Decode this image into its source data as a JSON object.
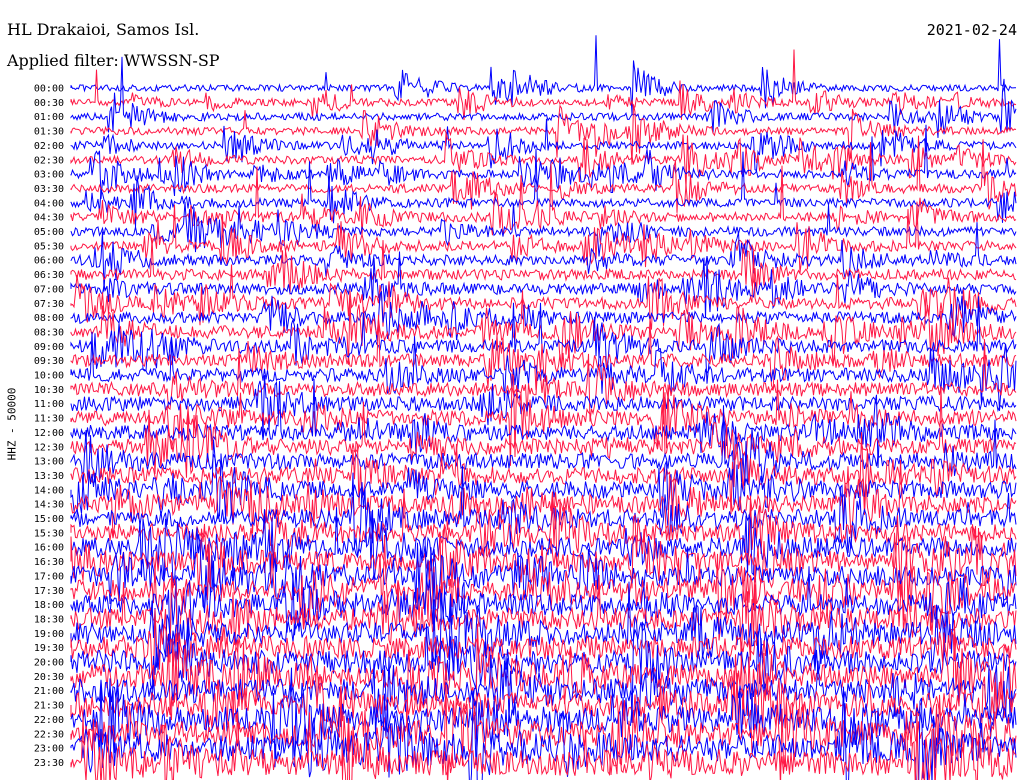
{
  "header": {
    "station": "HL Drakaioi, Samos Isl.",
    "date": "2021-02-24",
    "filter": "Applied filter: WWSSN-SP",
    "channel": "HHZ - 50000"
  },
  "colors": {
    "trace_a": "#0000ff",
    "trace_b": "#ff1744",
    "background": "#ffffff",
    "text": "#000000"
  },
  "chart_data": {
    "type": "line",
    "chart_kind": "helicorder",
    "grid": false,
    "trace_colors_alternating": [
      "#0000ff",
      "#ff1744"
    ],
    "row_labels": [
      "00:00",
      "00:30",
      "01:00",
      "01:30",
      "02:00",
      "02:30",
      "03:00",
      "03:30",
      "04:00",
      "04:30",
      "05:00",
      "05:30",
      "06:00",
      "06:30",
      "07:00",
      "07:30",
      "08:00",
      "08:30",
      "09:00",
      "09:30",
      "10:00",
      "10:30",
      "11:00",
      "11:30",
      "12:00",
      "12:30",
      "13:00",
      "13:30",
      "14:00",
      "14:30",
      "15:00",
      "15:30",
      "16:00",
      "16:30",
      "17:00",
      "17:30",
      "18:00",
      "18:30",
      "19:00",
      "19:30",
      "20:00",
      "20:30",
      "21:00",
      "21:30",
      "22:00",
      "22:30",
      "23:00",
      "23:30"
    ],
    "rows": [
      {
        "label": "00:00",
        "color": "#0000ff",
        "level": 0.1
      },
      {
        "label": "00:30",
        "color": "#ff1744",
        "level": 0.12
      },
      {
        "label": "01:00",
        "color": "#0000ff",
        "level": 0.14
      },
      {
        "label": "01:30",
        "color": "#ff1744",
        "level": 0.15
      },
      {
        "label": "02:00",
        "color": "#0000ff",
        "level": 0.16
      },
      {
        "label": "02:30",
        "color": "#ff1744",
        "level": 0.17
      },
      {
        "label": "03:00",
        "color": "#0000ff",
        "level": 0.18
      },
      {
        "label": "03:30",
        "color": "#ff1744",
        "level": 0.18
      },
      {
        "label": "04:00",
        "color": "#0000ff",
        "level": 0.2
      },
      {
        "label": "04:30",
        "color": "#ff1744",
        "level": 0.22
      },
      {
        "label": "05:00",
        "color": "#0000ff",
        "level": 0.22
      },
      {
        "label": "05:30",
        "color": "#ff1744",
        "level": 0.24
      },
      {
        "label": "06:00",
        "color": "#0000ff",
        "level": 0.26
      },
      {
        "label": "06:30",
        "color": "#ff1744",
        "level": 0.28
      },
      {
        "label": "07:00",
        "color": "#0000ff",
        "level": 0.3
      },
      {
        "label": "07:30",
        "color": "#ff1744",
        "level": 0.32
      },
      {
        "label": "08:00",
        "color": "#0000ff",
        "level": 0.33
      },
      {
        "label": "08:30",
        "color": "#ff1744",
        "level": 0.35
      },
      {
        "label": "09:00",
        "color": "#0000ff",
        "level": 0.37
      },
      {
        "label": "09:30",
        "color": "#ff1744",
        "level": 0.38
      },
      {
        "label": "10:00",
        "color": "#0000ff",
        "level": 0.4
      },
      {
        "label": "10:30",
        "color": "#ff1744",
        "level": 0.42
      },
      {
        "label": "11:00",
        "color": "#0000ff",
        "level": 0.44
      },
      {
        "label": "11:30",
        "color": "#ff1744",
        "level": 0.46
      },
      {
        "label": "12:00",
        "color": "#0000ff",
        "level": 0.48
      },
      {
        "label": "12:30",
        "color": "#ff1744",
        "level": 0.5
      },
      {
        "label": "13:00",
        "color": "#0000ff",
        "level": 0.52
      },
      {
        "label": "13:30",
        "color": "#ff1744",
        "level": 0.54
      },
      {
        "label": "14:00",
        "color": "#0000ff",
        "level": 0.56
      },
      {
        "label": "14:30",
        "color": "#ff1744",
        "level": 0.58
      },
      {
        "label": "15:00",
        "color": "#0000ff",
        "level": 0.6
      },
      {
        "label": "15:30",
        "color": "#ff1744",
        "level": 0.62
      },
      {
        "label": "16:00",
        "color": "#0000ff",
        "level": 0.64
      },
      {
        "label": "16:30",
        "color": "#ff1744",
        "level": 0.66
      },
      {
        "label": "17:00",
        "color": "#0000ff",
        "level": 0.68
      },
      {
        "label": "17:30",
        "color": "#ff1744",
        "level": 0.7
      },
      {
        "label": "18:00",
        "color": "#0000ff",
        "level": 0.72
      },
      {
        "label": "18:30",
        "color": "#ff1744",
        "level": 0.74
      },
      {
        "label": "19:00",
        "color": "#0000ff",
        "level": 0.76
      },
      {
        "label": "19:30",
        "color": "#ff1744",
        "level": 0.78
      },
      {
        "label": "20:00",
        "color": "#0000ff",
        "level": 0.8
      },
      {
        "label": "20:30",
        "color": "#ff1744",
        "level": 0.82
      },
      {
        "label": "21:00",
        "color": "#0000ff",
        "level": 0.84
      },
      {
        "label": "21:30",
        "color": "#ff1744",
        "level": 0.86
      },
      {
        "label": "22:00",
        "color": "#0000ff",
        "level": 0.88
      },
      {
        "label": "22:30",
        "color": "#ff1744",
        "level": 0.9
      },
      {
        "label": "23:00",
        "color": "#0000ff",
        "level": 0.92
      },
      {
        "label": "23:30",
        "color": "#ff1744",
        "level": 0.95
      }
    ]
  }
}
